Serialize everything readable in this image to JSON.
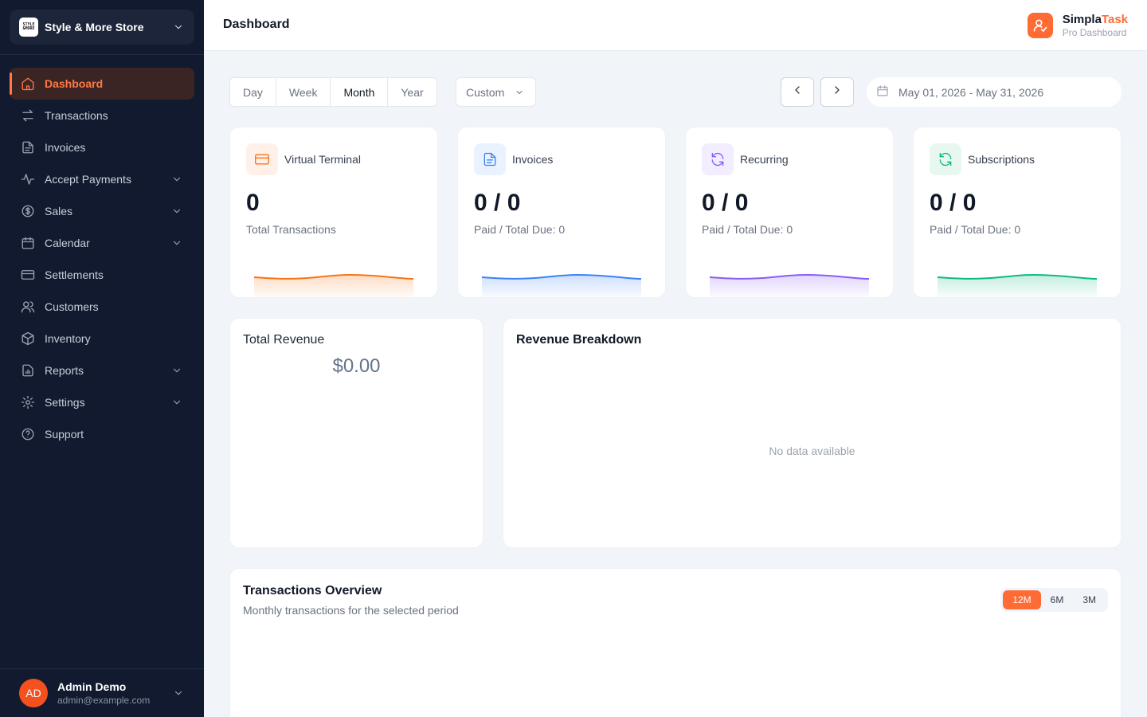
{
  "store": {
    "name": "Style & More Store",
    "logo_line1": "STYLE",
    "logo_line2": "&MORE"
  },
  "sidebar": {
    "items": [
      {
        "label": "Dashboard",
        "icon": "home-icon",
        "active": true,
        "expandable": false
      },
      {
        "label": "Transactions",
        "icon": "arrows-swap-icon",
        "expandable": false
      },
      {
        "label": "Invoices",
        "icon": "document-icon",
        "expandable": false
      },
      {
        "label": "Accept Payments",
        "icon": "activity-icon",
        "expandable": true
      },
      {
        "label": "Sales",
        "icon": "dollar-circle-icon",
        "expandable": true
      },
      {
        "label": "Calendar",
        "icon": "calendar-icon",
        "expandable": true
      },
      {
        "label": "Settlements",
        "icon": "card-icon",
        "expandable": false
      },
      {
        "label": "Customers",
        "icon": "users-icon",
        "expandable": false
      },
      {
        "label": "Inventory",
        "icon": "box-icon",
        "expandable": false
      },
      {
        "label": "Reports",
        "icon": "report-icon",
        "expandable": true
      },
      {
        "label": "Settings",
        "icon": "gear-icon",
        "expandable": true
      },
      {
        "label": "Support",
        "icon": "help-circle-icon",
        "expandable": false
      }
    ]
  },
  "user": {
    "initials": "AD",
    "name": "Admin Demo",
    "email": "admin@example.com"
  },
  "header": {
    "title": "Dashboard"
  },
  "brand": {
    "name_part1": "Simpla",
    "name_part2": "Task",
    "subtitle": "Pro Dashboard",
    "color": "#ff6b35"
  },
  "toolbar": {
    "periods": [
      "Day",
      "Week",
      "Month",
      "Year"
    ],
    "active_period": "Month",
    "custom_label": "Custom",
    "date_range": "May 01, 2026 - May 31, 2026"
  },
  "stats": [
    {
      "label": "Virtual Terminal",
      "value": "0",
      "sub": "Total Transactions",
      "icon": "credit-card-icon",
      "color": "#f97316",
      "tint": "#fff1ea"
    },
    {
      "label": "Invoices",
      "value": "0 / 0",
      "sub": "Paid / Total Due: 0",
      "icon": "document-icon",
      "color": "#3b82f6",
      "tint": "#eaf2ff"
    },
    {
      "label": "Recurring",
      "value": "0 / 0",
      "sub": "Paid / Total Due: 0",
      "icon": "refresh-icon",
      "color": "#8b5cf6",
      "tint": "#f2edff"
    },
    {
      "label": "Subscriptions",
      "value": "0 / 0",
      "sub": "Paid / Total Due: 0",
      "icon": "refresh-icon",
      "color": "#10b981",
      "tint": "#e8f8f1"
    }
  ],
  "revenue": {
    "title": "Total Revenue",
    "amount": "$0.00"
  },
  "breakdown": {
    "title": "Revenue Breakdown",
    "empty": "No data available"
  },
  "transactions": {
    "title": "Transactions Overview",
    "subtitle": "Monthly transactions for the selected period",
    "ranges": [
      "12M",
      "6M",
      "3M"
    ],
    "active_range": "12M"
  }
}
